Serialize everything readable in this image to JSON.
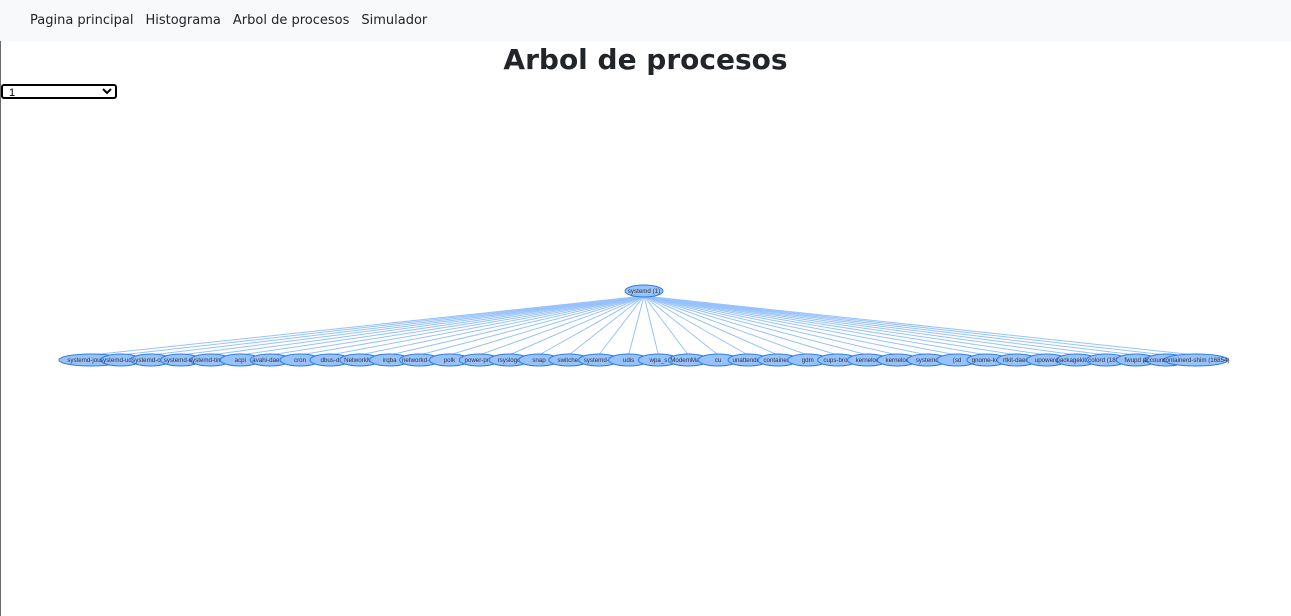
{
  "nav": {
    "items": [
      "Pagina principal",
      "Histograma",
      "Arbol de procesos",
      "Simulador"
    ]
  },
  "page": {
    "title": "Arbol de procesos"
  },
  "pid_select": {
    "value": "1"
  },
  "tree": {
    "root": "systemd (1)",
    "children": [
      "systemd-journal (",
      "systemd-udevd",
      "systemd-oom",
      "systemd-res",
      "systemd-timesy",
      "acpi",
      "avahi-daemo",
      "cron",
      "dbus-d",
      "NetworkMa",
      "irqba",
      "networkd-dis",
      "polk",
      "power-prof",
      "rsyslogd",
      "snap",
      "switcher",
      "systemd-lo",
      "udis",
      "wpa_s",
      "ModemMana",
      "cu",
      "unattended",
      "containerd",
      "gdm",
      "cups-brow",
      "kerneloo",
      "kerneloo",
      "systemd",
      "(sd",
      "gnome-key",
      "rtkit-daem",
      "upowerd",
      "packagekitd (1",
      "colord (1882)",
      "fwupd (2",
      "accounts-daemo",
      "containerd-shim (16854)"
    ],
    "colors": {
      "edge": "#97c2fc",
      "node_fill": "#97c2fc",
      "node_border": "#2b7ce9"
    }
  }
}
